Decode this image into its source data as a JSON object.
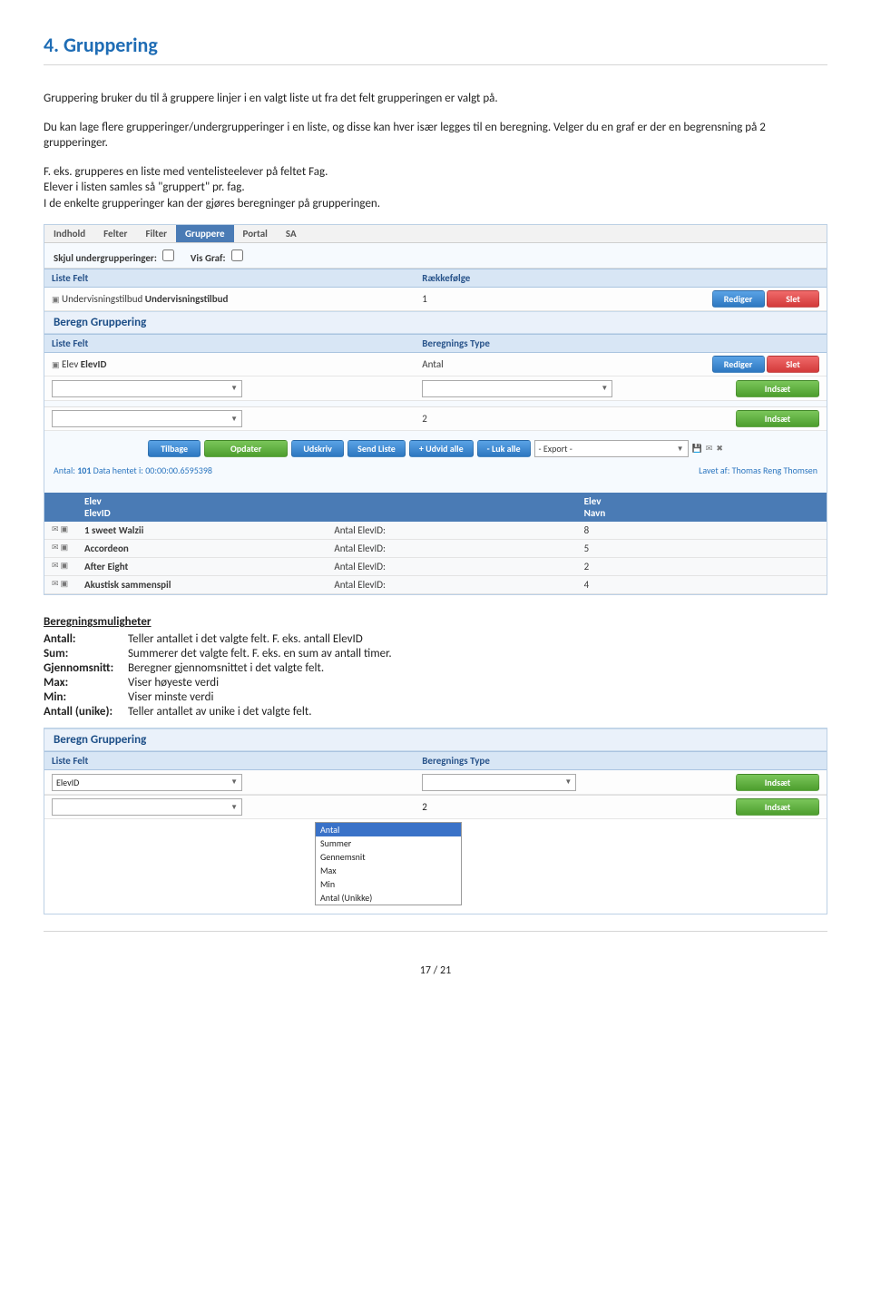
{
  "title": "4. Gruppering",
  "paras": {
    "p1": "Gruppering bruker du til å gruppere linjer i en valgt liste ut fra det felt grupperingen er valgt på.",
    "p2": "Du kan lage flere grupperinger/undergrupperinger i en liste, og disse kan hver især legges til en beregning. Velger du en graf er der en begrensning på 2 grupperinger.",
    "p3a": "F. eks. grupperes en liste med ventelisteelever på feltet Fag.",
    "p3b": "Elever i listen samles så \"gruppert\" pr. fag.",
    "p3c": "I de enkelte grupperinger kan der gjøres beregninger på grupperingen."
  },
  "shot1": {
    "tabs": [
      "Indhold",
      "Felter",
      "Filter",
      "Gruppere",
      "Portal",
      "SA"
    ],
    "active_tab": 3,
    "subbar_a": "Skjul undergrupperinger:",
    "subbar_b": "Vis Graf:",
    "th_liste": "Liste Felt",
    "th_raek": "Rækkefølge",
    "row1_label_prefix": "Undervisningstilbud ",
    "row1_label_bold": "Undervisningstilbud",
    "row1_val": "1",
    "btn_edit": "Rediger",
    "btn_del": "Slet",
    "beregn_head": "Beregn Gruppering",
    "th_bt": "Beregnings Type",
    "row2_label_prefix": "Elev ",
    "row2_label_bold": "ElevID",
    "row2_val": "Antal",
    "btn_insert": "Indsæt",
    "bottom_val": "2",
    "actions": [
      "Tilbage",
      "Opdater",
      "Udskriv",
      "Send Liste",
      "+ Udvid alle",
      "- Luk alle"
    ],
    "export": "- Export -",
    "status_left_a": "Antal: ",
    "status_left_b": "101",
    "status_left_c": " Data hentet i: 00:00:00.6595398",
    "status_right_a": "Lavet af: ",
    "status_right_b": "Thomas Reng Thomsen"
  },
  "grid": {
    "h1": "Elev",
    "h1b": "ElevID",
    "h2": "Elev",
    "h2b": "Navn",
    "mid": "Antal ElevID:",
    "rows": [
      {
        "name": "1 sweet Walzii",
        "val": "8"
      },
      {
        "name": "Accordeon",
        "val": "5"
      },
      {
        "name": "After Eight",
        "val": "2"
      },
      {
        "name": "Akustisk sammenspil",
        "val": "4"
      }
    ]
  },
  "defs": {
    "head": "Beregningsmuligheter",
    "items": [
      {
        "k": "Antall",
        "d": "Teller antallet i det valgte felt. F. eks. antall ElevID"
      },
      {
        "k": "Sum",
        "d": "Summerer det valgte felt. F. eks. en sum av antall timer."
      },
      {
        "k": "Gjennomsnitt",
        "d": "Beregner gjennomsnittet i det valgte felt."
      },
      {
        "k": "Max",
        "d": "Viser høyeste verdi"
      },
      {
        "k": "Min",
        "d": "Viser minste verdi"
      },
      {
        "k": "Antall (unike)",
        "d": "Teller antallet av unike i det valgte felt."
      }
    ]
  },
  "shot2": {
    "head": "Beregn Gruppering",
    "th_liste": "Liste Felt",
    "th_bt": "Beregnings Type",
    "sel_val": "ElevID",
    "btn_insert": "Indsæt",
    "bottom_val": "2",
    "options": [
      "Antal",
      "Summer",
      "Gennemsnit",
      "Max",
      "Min",
      "Antal (Unikke)"
    ]
  },
  "page": "17 / 21"
}
